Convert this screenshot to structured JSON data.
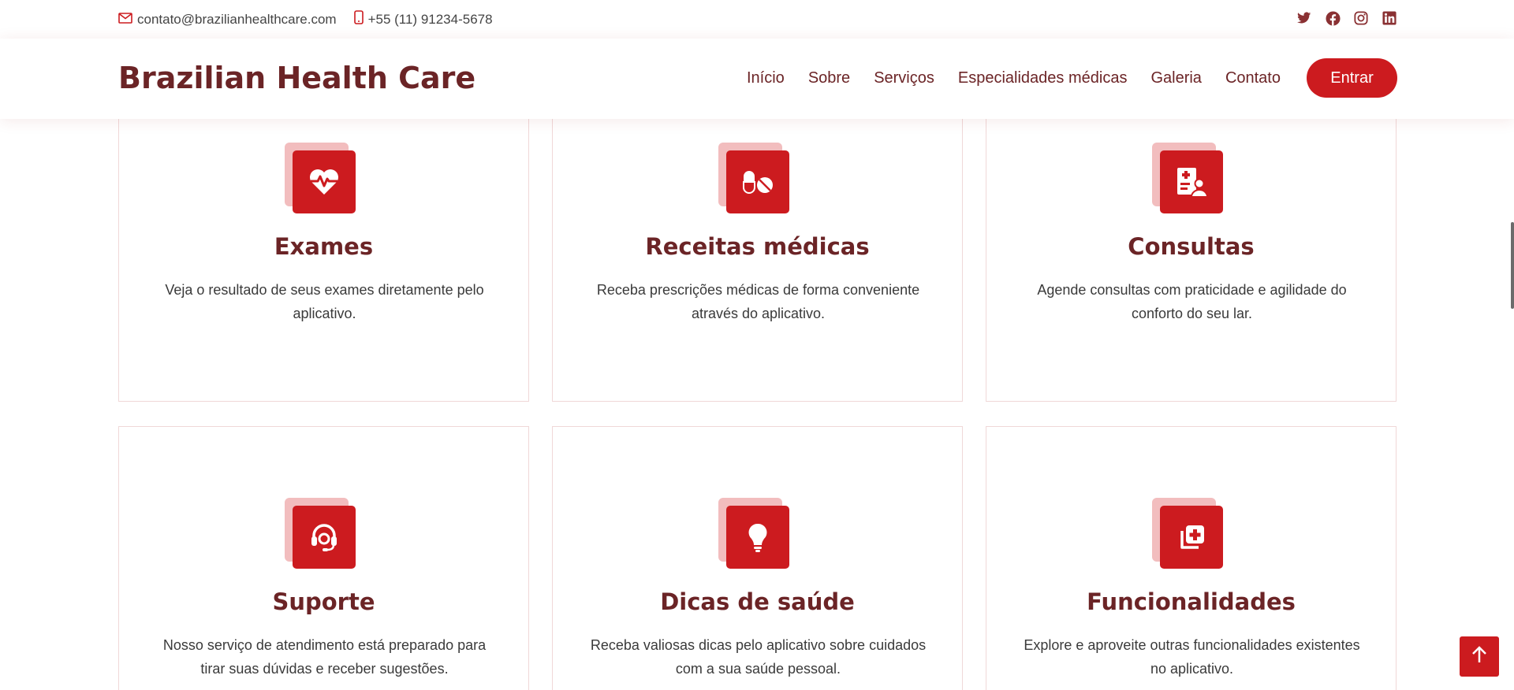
{
  "topbar": {
    "email": "contato@brazilianhealthcare.com",
    "phone": "+55 (11) 91234-5678",
    "social": [
      "twitter-icon",
      "facebook-icon",
      "instagram-icon",
      "linkedin-icon"
    ]
  },
  "header": {
    "logo": "Brazilian Health Care",
    "nav": [
      "Início",
      "Sobre",
      "Serviços",
      "Especialidades médicas",
      "Galeria",
      "Contato"
    ],
    "cta": "Entrar"
  },
  "services": [
    {
      "icon": "heart-pulse-icon",
      "title": "Exames",
      "text": "Veja o resultado de seus exames diretamente pelo aplicativo."
    },
    {
      "icon": "pills-icon",
      "title": "Receitas médicas",
      "text": "Receba prescrições médicas de forma conveniente através do aplicativo."
    },
    {
      "icon": "medical-record-icon",
      "title": "Consultas",
      "text": "Agende consultas com praticidade e agilidade do conforto do seu lar."
    },
    {
      "icon": "headset-icon",
      "title": "Suporte",
      "text": "Nosso serviço de atendimento está preparado para tirar suas dúvidas e receber sugestões."
    },
    {
      "icon": "lightbulb-icon",
      "title": "Dicas de saúde",
      "text": "Receba valiosas dicas pelo aplicativo sobre cuidados com a sua saúde pessoal."
    },
    {
      "icon": "copy-plus-icon",
      "title": "Funcionalidades",
      "text": "Explore e aproveite outras funcionalidades existentes no aplicativo."
    }
  ],
  "colors": {
    "brand": "#6b2426",
    "accent": "#cc1b1f",
    "accent_light": "#f2bdbe",
    "card_border": "#f0d8d8"
  }
}
